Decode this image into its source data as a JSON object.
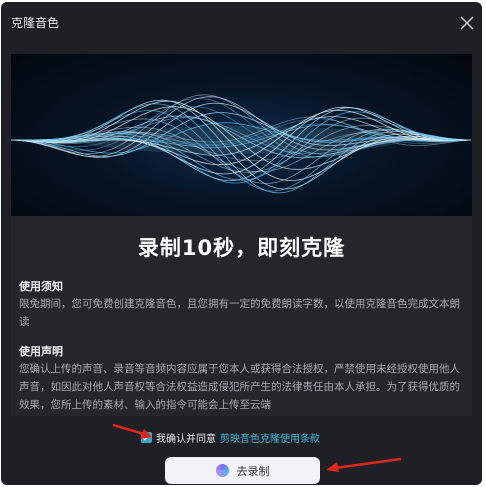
{
  "dialog": {
    "title": "克隆音色",
    "close_icon": "close-icon"
  },
  "hero": {
    "title": "录制10秒，即刻克隆"
  },
  "notice": {
    "title": "使用须知",
    "body": "限免期间，您可免费创建克隆音色，且您拥有一定的免费朗读字数，以使用克隆音色完成文本朗读"
  },
  "statement": {
    "title": "使用声明",
    "body": "您确认上传的声音、录音等音频内容应属于您本人或获得合法授权，严禁使用未经授权使用他人声音，如因此对他人声音权等合法权益造成侵犯所产生的法律责任由本人承担。为了获得优质的效果，您所上传的素材、输入的指令可能会上传至云端"
  },
  "agreement": {
    "checked": true,
    "text": "我确认并同意",
    "link": "剪映音色克隆使用条款"
  },
  "record_button": {
    "label": "去录制"
  },
  "colors": {
    "accent": "#3fb6d6",
    "arrow": "#e0251b",
    "dialog_bg": "#1f2026"
  }
}
